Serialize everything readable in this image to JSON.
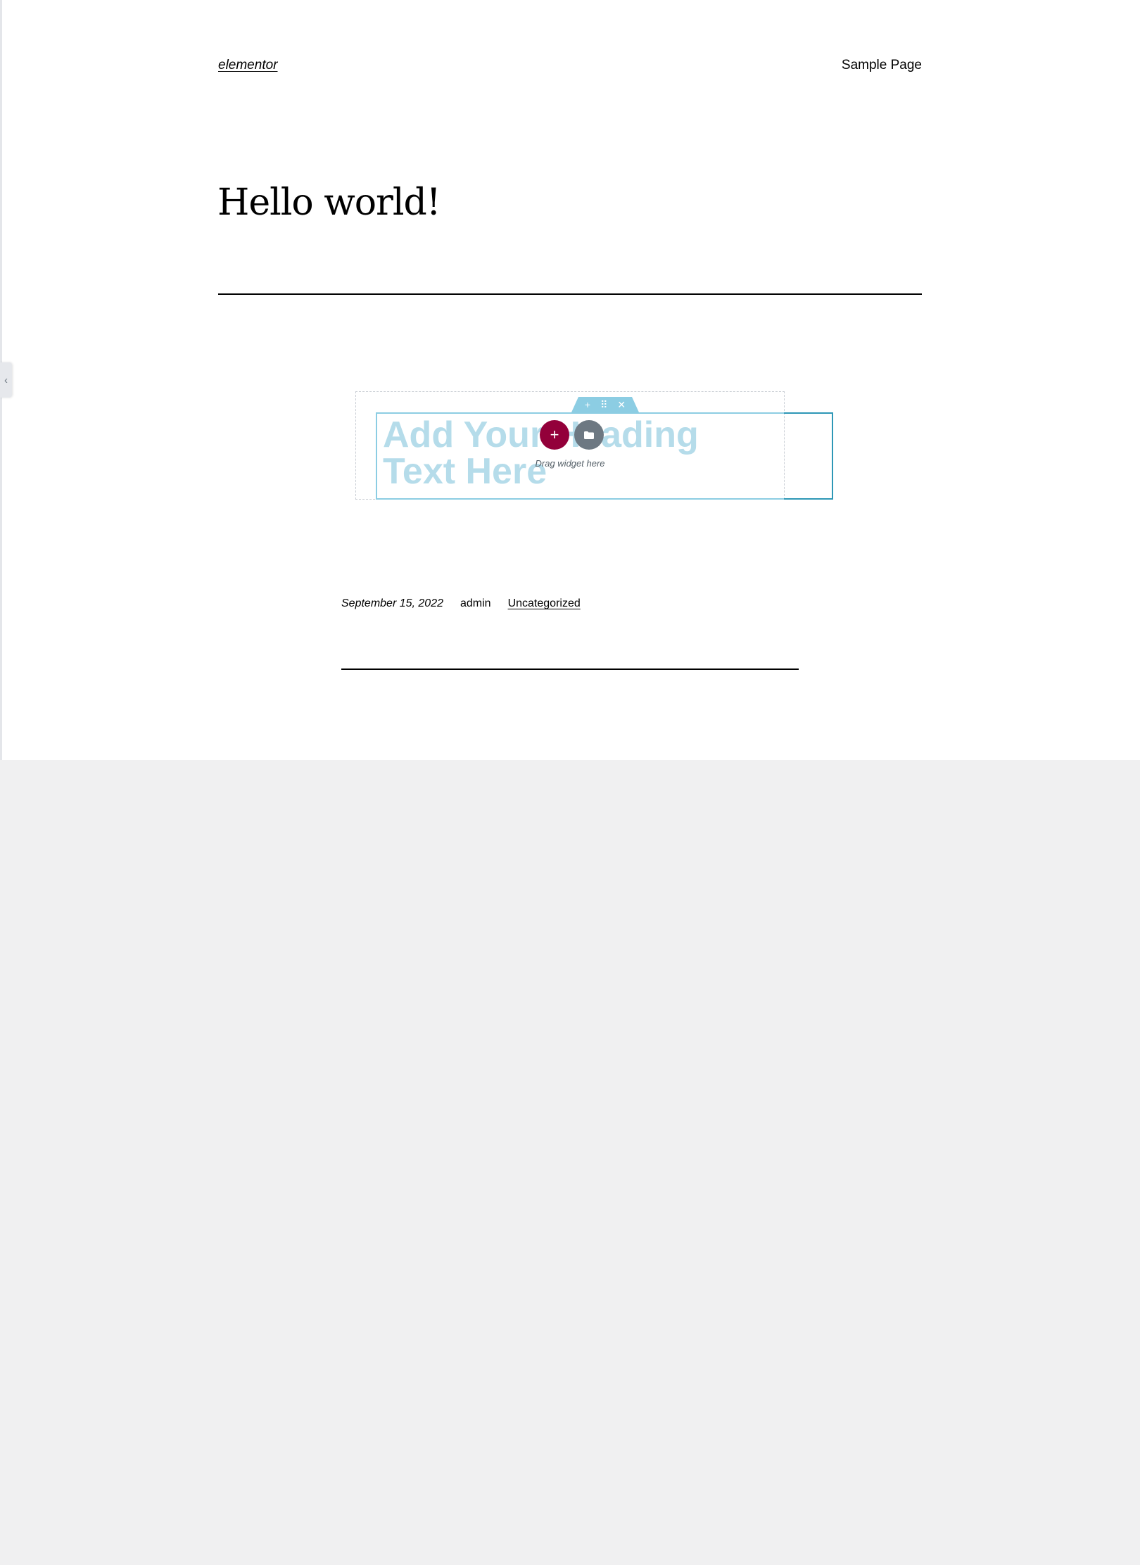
{
  "header": {
    "site_title": "elementor",
    "nav_item": "Sample Page"
  },
  "post": {
    "title": "Hello world!",
    "date": "September 15, 2022",
    "author": "admin",
    "category": "Uncategorized"
  },
  "editor": {
    "section_handle": {
      "add_glyph": "+",
      "move_glyph": "⠿",
      "close_glyph": "✕"
    },
    "heading_placeholder": "Add Your Heading Text Here",
    "add_button_glyph": "+",
    "drag_hint": "Drag widget here",
    "panel_toggle_glyph": "‹"
  },
  "colors": {
    "accent": "#93003a",
    "handle": "#8ccde3",
    "widget_border": "#2d97b6",
    "placeholder_text": "#b5dcea",
    "neutral_button": "#6d7882"
  }
}
